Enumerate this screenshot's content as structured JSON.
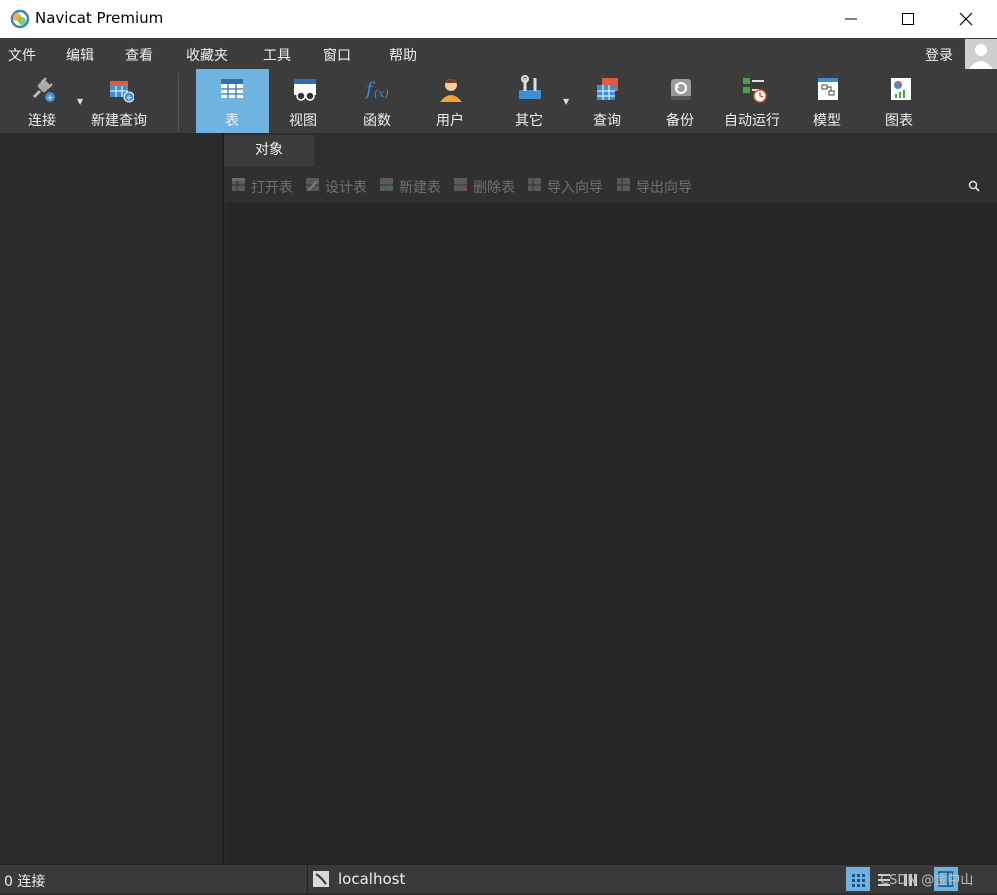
{
  "window": {
    "title": "Navicat Premium"
  },
  "menu": {
    "items": [
      "文件",
      "编辑",
      "查看",
      "收藏夹",
      "工具",
      "窗口",
      "帮助"
    ],
    "login": "登录"
  },
  "toolbar": {
    "connect": "连接",
    "new_query": "新建查询",
    "table": "表",
    "view": "视图",
    "function": "函数",
    "user": "用户",
    "other": "其它",
    "query": "查询",
    "backup": "备份",
    "automation": "自动运行",
    "model": "模型",
    "chart": "图表"
  },
  "tabs": {
    "objects": "对象"
  },
  "object_toolbar": {
    "open_table": "打开表",
    "design_table": "设计表",
    "new_table": "新建表",
    "delete_table": "删除表",
    "import_wizard": "导入向导",
    "export_wizard": "导出向导"
  },
  "status": {
    "connections": "0 连接",
    "host": "localhost",
    "watermark": "CSDN @金中山"
  },
  "colors": {
    "active_accent": "#6fb3e0",
    "toolbar_bg": "#3c3c3c",
    "panel_bg": "#2b2b2b"
  }
}
